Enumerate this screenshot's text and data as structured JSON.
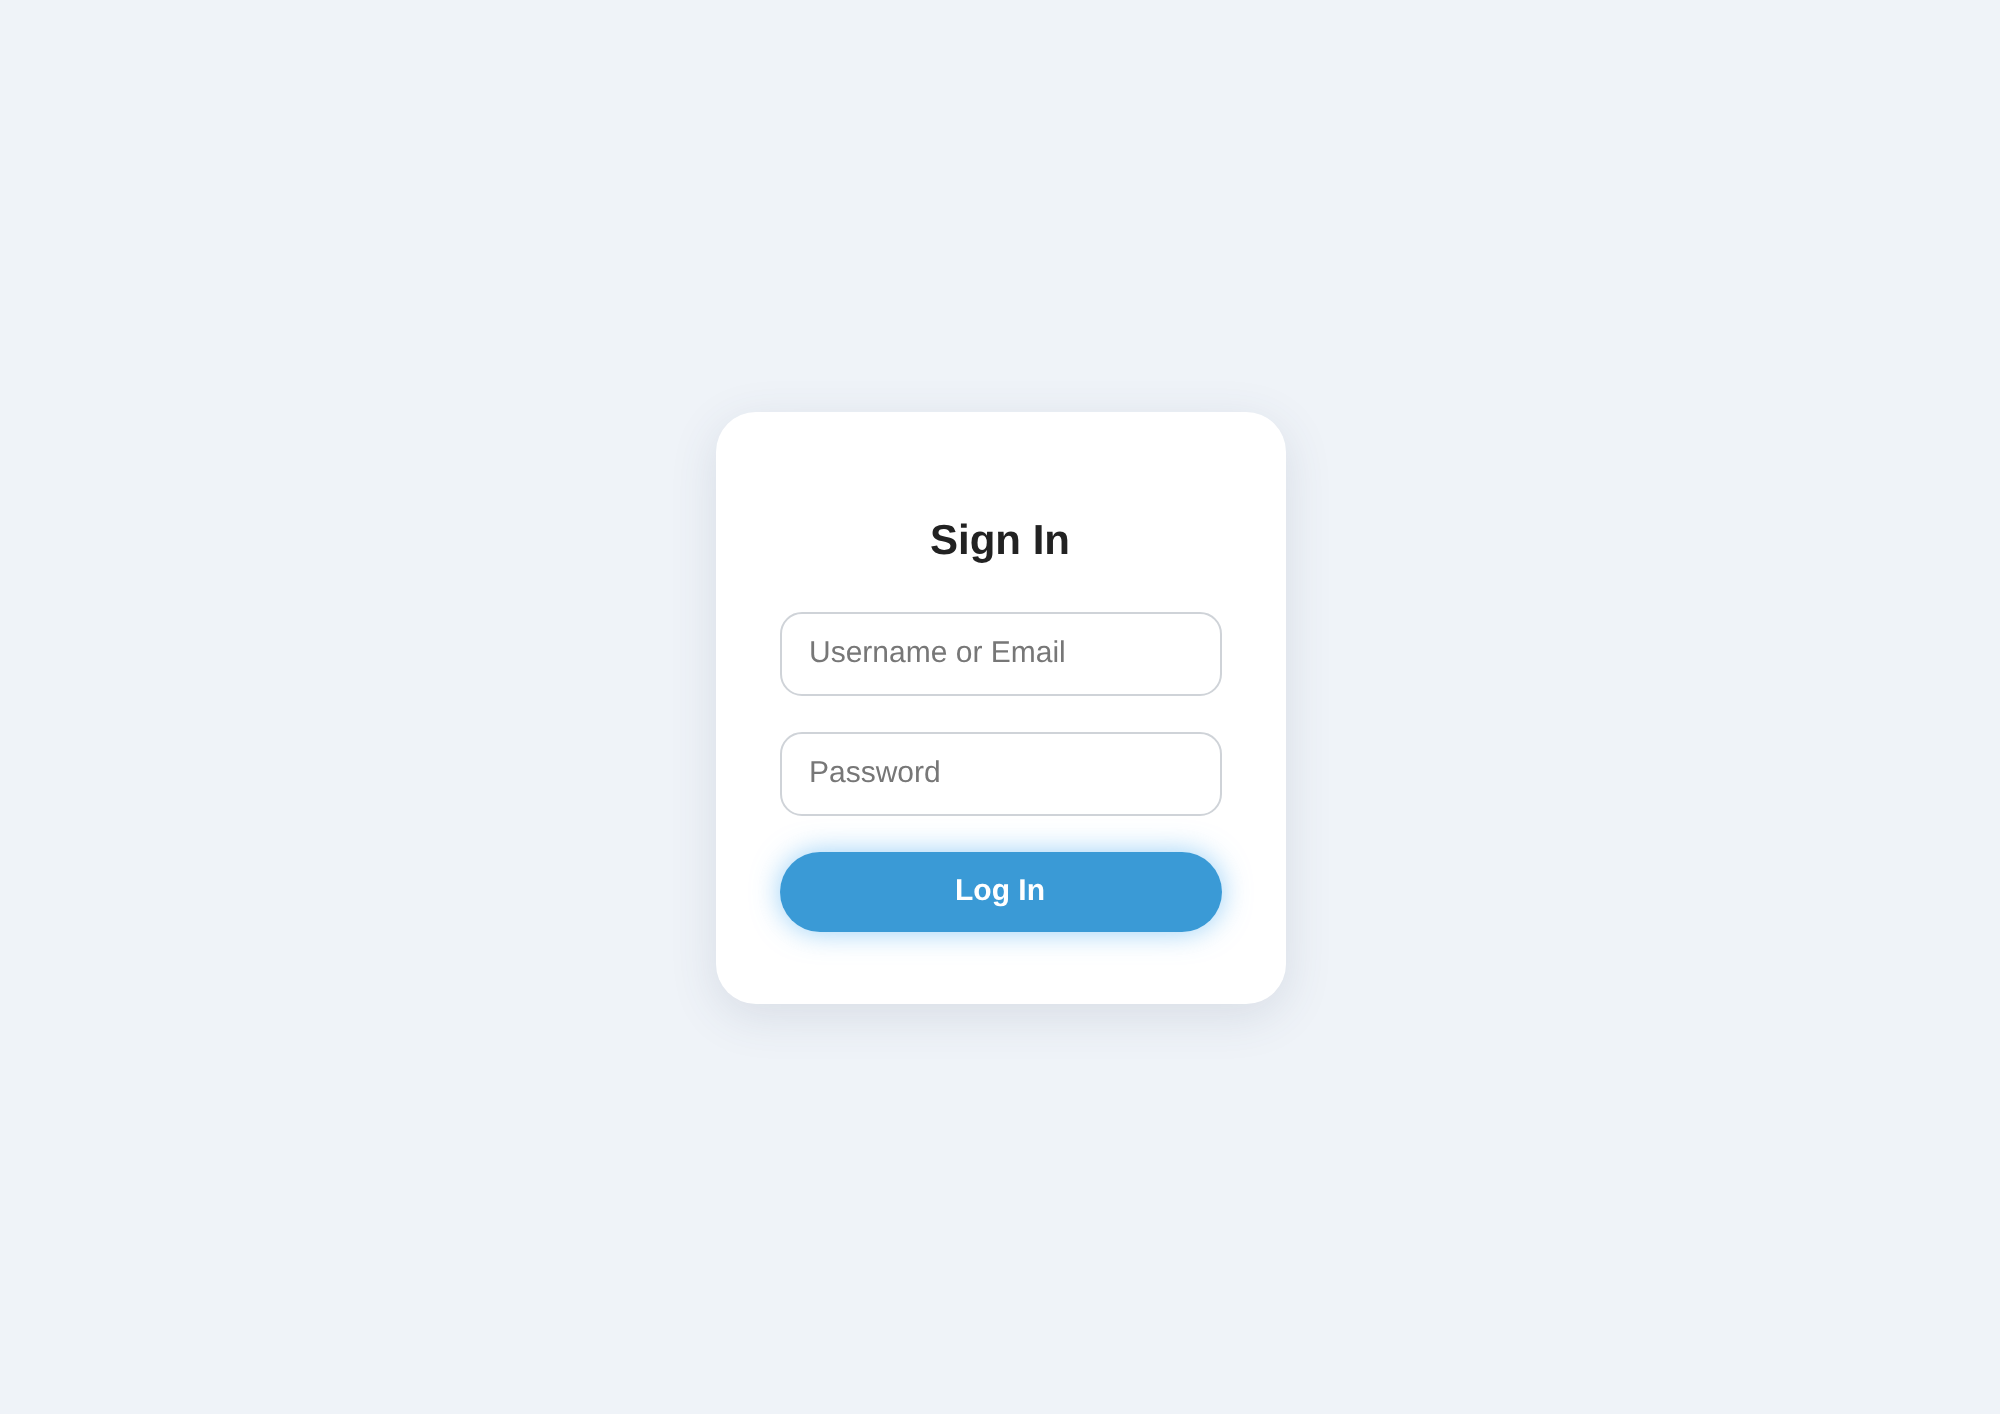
{
  "form": {
    "title": "Sign In",
    "fields": [
      {
        "placeholder": "Username or Email"
      },
      {
        "placeholder": "Password"
      }
    ],
    "button": "Log In"
  }
}
